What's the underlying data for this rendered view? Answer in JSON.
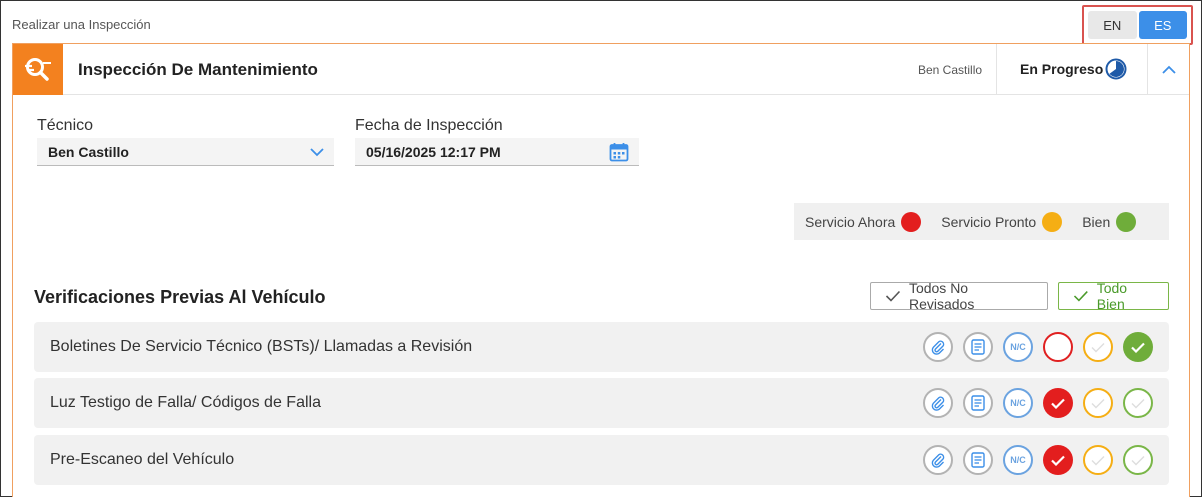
{
  "page": {
    "title": "Realizar una Inspección"
  },
  "language": {
    "en_label": "EN",
    "es_label": "ES",
    "selected": "ES"
  },
  "header": {
    "title": "Inspección De Mantenimiento",
    "user": "Ben Castillo",
    "status": "En Progreso",
    "icon": "inspection-icon",
    "accent_color": "#f3811f"
  },
  "fields": {
    "technician": {
      "label": "Técnico",
      "value": "Ben Castillo"
    },
    "date": {
      "label": "Fecha de Inspección",
      "value": "05/16/2025 12:17 PM"
    }
  },
  "legend": [
    {
      "label": "Servicio Ahora",
      "color": "#e31e1e"
    },
    {
      "label": "Servicio Pronto",
      "color": "#f5ae14"
    },
    {
      "label": "Bien",
      "color": "#6fad3a"
    }
  ],
  "section": {
    "title": "Verificaciones Previas Al Vehículo",
    "btn_not_reviewed": "Todos No Revisados",
    "btn_all_ok": "Todo Bien"
  },
  "na_label": "N/C",
  "rows": [
    {
      "label": "Boletines De Servicio Técnico (BSTs)/ Llamadas a Revisión",
      "selected": "good"
    },
    {
      "label": "Luz Testigo de Falla/ Códigos de Falla",
      "selected": "now"
    },
    {
      "label": "Pre-Escaneo del Vehículo",
      "selected": "now"
    }
  ]
}
